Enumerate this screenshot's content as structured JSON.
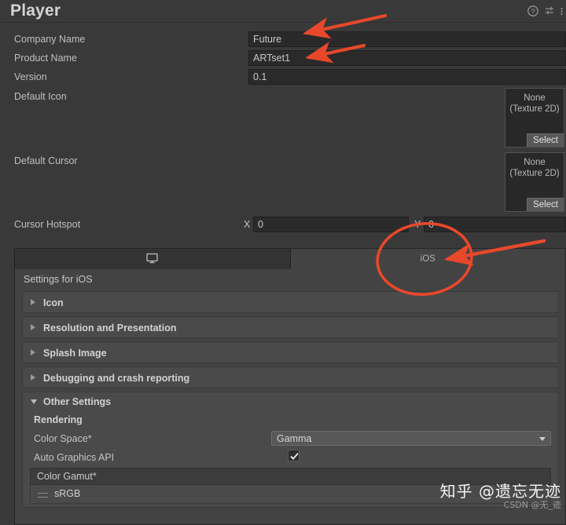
{
  "header": {
    "title": "Player",
    "icons": [
      {
        "name": "help-icon",
        "glyph": "?"
      },
      {
        "name": "preset-settings-icon",
        "glyph": "sliders"
      },
      {
        "name": "more-menu-icon",
        "glyph": "kebab"
      }
    ]
  },
  "general": {
    "rows": [
      {
        "label": "Company Name",
        "value": "Future"
      },
      {
        "label": "Product Name",
        "value": "ARTset1"
      },
      {
        "label": "Version",
        "value": "0.1"
      }
    ],
    "default_icon": {
      "label": "Default Icon",
      "object_line1": "None",
      "object_line2": "(Texture 2D)",
      "select_label": "Select"
    },
    "default_cursor": {
      "label": "Default Cursor",
      "object_line1": "None",
      "object_line2": "(Texture 2D)",
      "select_label": "Select"
    },
    "cursor_hotspot": {
      "label": "Cursor Hotspot",
      "x_label": "X",
      "x_value": "0",
      "y_label": "Y",
      "y_value": "0"
    }
  },
  "platform": {
    "tabs": [
      {
        "name": "standalone",
        "label": "",
        "icon": "monitor-icon",
        "active": false
      },
      {
        "name": "ios",
        "label": "iOS",
        "icon": "",
        "active": true
      }
    ],
    "settings_title": "Settings for iOS",
    "foldouts": [
      {
        "label": "Icon",
        "expanded": false
      },
      {
        "label": "Resolution and Presentation",
        "expanded": false
      },
      {
        "label": "Splash Image",
        "expanded": false
      },
      {
        "label": "Debugging and crash reporting",
        "expanded": false
      }
    ],
    "other_settings": {
      "label": "Other Settings",
      "expanded": true,
      "section_label": "Rendering",
      "color_space": {
        "label": "Color Space*",
        "value": "Gamma"
      },
      "auto_graphics_api": {
        "label": "Auto Graphics API",
        "checked": true
      },
      "color_gamut": {
        "label": "Color Gamut*",
        "items": [
          {
            "value": "sRGB"
          }
        ]
      }
    }
  },
  "annotations": {
    "accent_color": "#e8482a",
    "arrows": [
      {
        "name": "arrow-company-name"
      },
      {
        "name": "arrow-product-name"
      },
      {
        "name": "arrow-ios-tab"
      }
    ],
    "ellipses": [
      {
        "name": "ellipse-ios-tab"
      }
    ]
  },
  "watermark": {
    "primary": "知乎 @遗忘无迹",
    "secondary": "CSDN @无_迹"
  }
}
